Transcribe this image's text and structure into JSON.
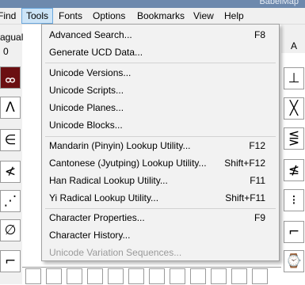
{
  "window": {
    "title_fragment": "BabelMap"
  },
  "menubar": {
    "items": [
      {
        "label": "Find"
      },
      {
        "label": "Tools"
      },
      {
        "label": "Fonts"
      },
      {
        "label": "Options"
      },
      {
        "label": "Bookmarks"
      },
      {
        "label": "View"
      },
      {
        "label": "Help"
      }
    ],
    "active": "Tools"
  },
  "background": {
    "left_label": "agual",
    "left_number": "0",
    "right_label": "A",
    "left_glyphs": [
      "ᢁ",
      "Λ",
      "∈",
      "≮",
      "⋰",
      "∅",
      "⌐"
    ],
    "right_glyphs": [
      "⊥",
      "╳",
      "⋚",
      "≰",
      "⁝",
      "⌐",
      "⌚"
    ]
  },
  "tools_menu": {
    "groups": [
      [
        {
          "label": "Advanced Search...",
          "shortcut": "F8",
          "enabled": true
        },
        {
          "label": "Generate UCD Data...",
          "shortcut": "",
          "enabled": true
        }
      ],
      [
        {
          "label": "Unicode Versions...",
          "shortcut": "",
          "enabled": true
        },
        {
          "label": "Unicode Scripts...",
          "shortcut": "",
          "enabled": true
        },
        {
          "label": "Unicode Planes...",
          "shortcut": "",
          "enabled": true
        },
        {
          "label": "Unicode Blocks...",
          "shortcut": "",
          "enabled": true
        }
      ],
      [
        {
          "label": "Mandarin (Pinyin) Lookup Utility...",
          "shortcut": "F12",
          "enabled": true
        },
        {
          "label": "Cantonese (Jyutping) Lookup Utility...",
          "shortcut": "Shift+F12",
          "enabled": true
        },
        {
          "label": "Han Radical Lookup Utility...",
          "shortcut": "F11",
          "enabled": true
        },
        {
          "label": "Yi Radical Lookup Utility...",
          "shortcut": "Shift+F11",
          "enabled": true
        }
      ],
      [
        {
          "label": "Character Properties...",
          "shortcut": "F9",
          "enabled": true
        },
        {
          "label": "Character History...",
          "shortcut": "",
          "enabled": true
        },
        {
          "label": "Unicode Variation Sequences...",
          "shortcut": "",
          "enabled": false
        }
      ]
    ]
  }
}
